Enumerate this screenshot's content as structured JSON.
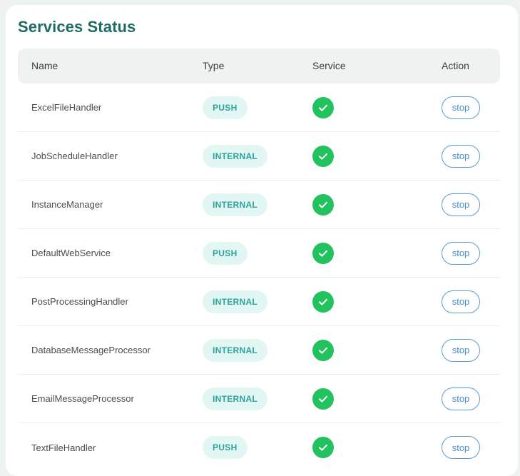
{
  "page": {
    "title": "Services Status"
  },
  "table": {
    "headers": {
      "name": "Name",
      "type": "Type",
      "service": "Service",
      "action": "Action"
    },
    "rows": [
      {
        "name": "ExcelFileHandler",
        "type": "PUSH",
        "service_status": "running",
        "action": "stop"
      },
      {
        "name": "JobScheduleHandler",
        "type": "INTERNAL",
        "service_status": "running",
        "action": "stop"
      },
      {
        "name": "InstanceManager",
        "type": "INTERNAL",
        "service_status": "running",
        "action": "stop"
      },
      {
        "name": "DefaultWebService",
        "type": "PUSH",
        "service_status": "running",
        "action": "stop"
      },
      {
        "name": "PostProcessingHandler",
        "type": "INTERNAL",
        "service_status": "running",
        "action": "stop"
      },
      {
        "name": "DatabaseMessageProcessor",
        "type": "INTERNAL",
        "service_status": "running",
        "action": "stop"
      },
      {
        "name": "EmailMessageProcessor",
        "type": "INTERNAL",
        "service_status": "running",
        "action": "stop"
      },
      {
        "name": "TextFileHandler",
        "type": "PUSH",
        "service_status": "running",
        "action": "stop"
      }
    ]
  },
  "icons": {
    "service_ok": "check-circle-icon"
  },
  "colors": {
    "title": "#1f6b66",
    "badge_bg": "#e2f6f4",
    "badge_text": "#2aa39a",
    "status_ok": "#22c35e",
    "action_border": "#5a9bd6",
    "action_text": "#4a8fd0",
    "header_bg": "#f0f1f1"
  }
}
